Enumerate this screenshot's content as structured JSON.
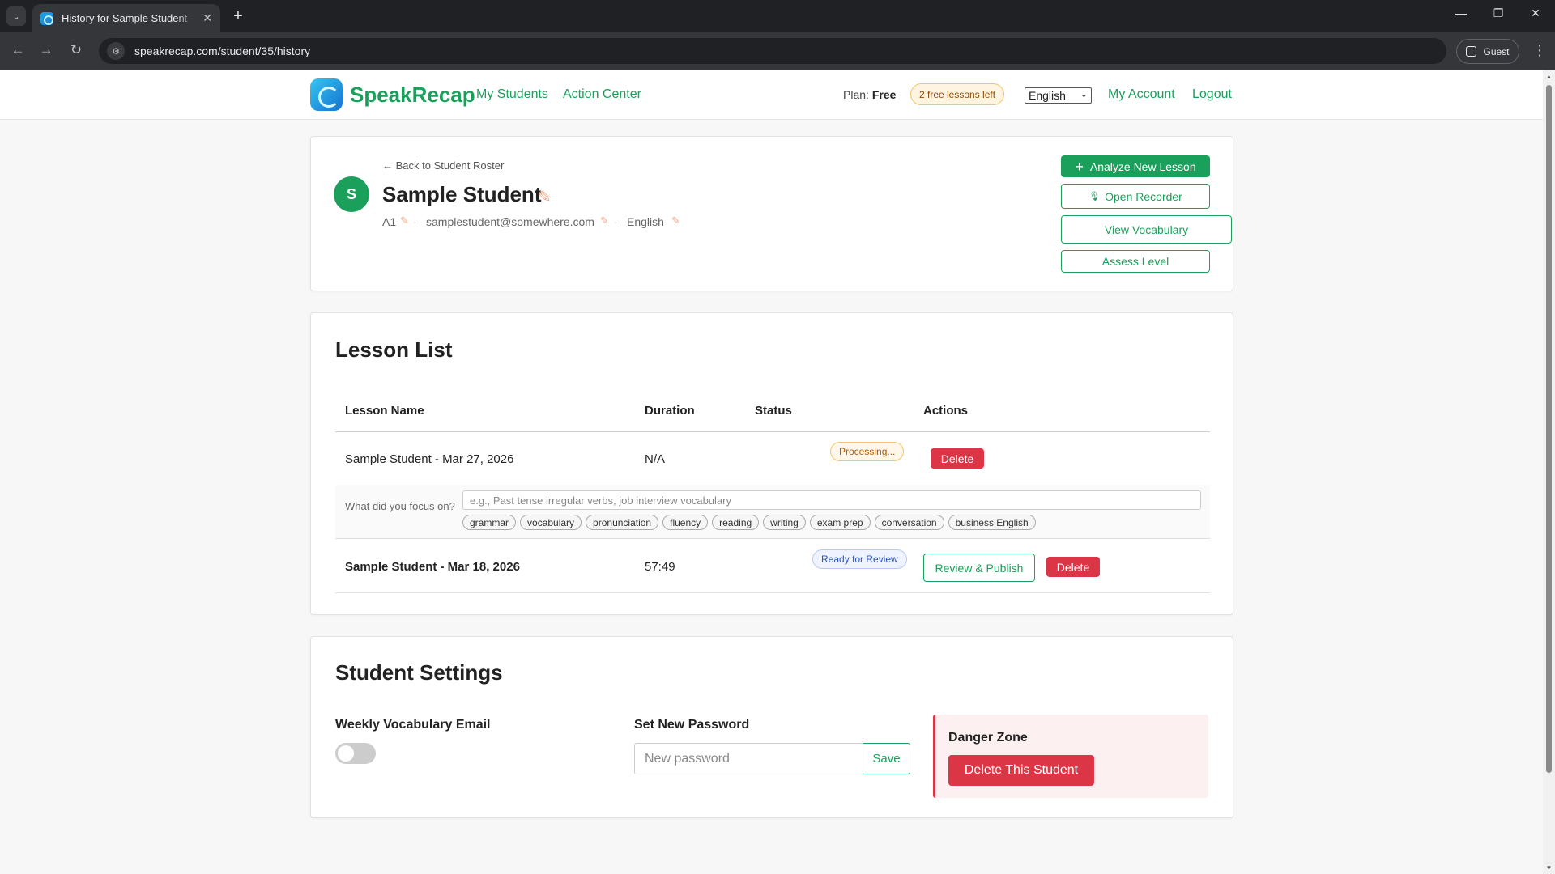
{
  "browser": {
    "tab_title": "History for Sample Student - SpeakRecap",
    "url": "speakrecap.com/student/35/history",
    "profile": "Guest"
  },
  "header": {
    "brand": "SpeakRecap",
    "nav": [
      "My Students",
      "Action Center"
    ],
    "plan_label": "Plan:",
    "plan_value": "Free",
    "free_badge": "2 free lessons left",
    "language": "English",
    "my_account": "My Account",
    "logout": "Logout"
  },
  "student": {
    "back_link": "← Back to Student Roster",
    "initial": "S",
    "name": "Sample Student",
    "level": "A1",
    "email": "samplestudent@somewhere.com",
    "language": "English",
    "actions": {
      "analyze": "Analyze New Lesson",
      "recorder": "Open Recorder",
      "vocabulary": "View Vocabulary",
      "assess": "Assess Level"
    }
  },
  "lessons": {
    "title": "Lesson List",
    "columns": [
      "Lesson Name",
      "Duration",
      "Status",
      "Actions"
    ],
    "rows": [
      {
        "name": "Sample Student - Mar 27, 2026",
        "duration": "N/A",
        "status": "Processing...",
        "delete": "Delete"
      },
      {
        "name": "Sample Student - Mar 18, 2026",
        "duration": "57:49",
        "status": "Ready for Review",
        "review": "Review & Publish",
        "delete": "Delete"
      }
    ],
    "focus": {
      "label": "What did you focus on?",
      "placeholder": "e.g., Past tense irregular verbs, job interview vocabulary",
      "chips": [
        "grammar",
        "vocabulary",
        "pronunciation",
        "fluency",
        "reading",
        "writing",
        "exam prep",
        "conversation",
        "business English"
      ]
    }
  },
  "settings": {
    "title": "Student Settings",
    "weekly_email_label": "Weekly Vocabulary Email",
    "weekly_email_enabled": false,
    "password_label": "Set New Password",
    "password_placeholder": "New password",
    "save": "Save",
    "danger_title": "Danger Zone",
    "danger_button": "Delete This Student"
  },
  "colors": {
    "brand_green": "#1aa05b",
    "danger_red": "#dc3545"
  }
}
